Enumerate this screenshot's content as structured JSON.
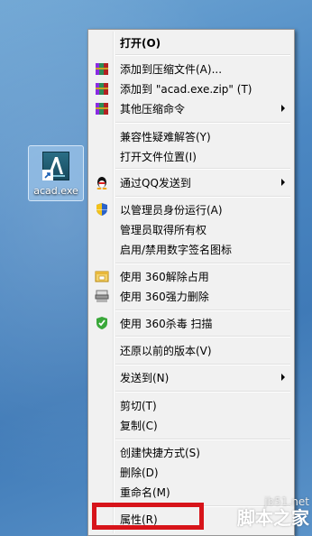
{
  "desktop": {
    "icon_label": "acad.exe"
  },
  "menu": {
    "items": [
      {
        "label": "打开(O)",
        "bold": true,
        "icon": ""
      },
      {
        "label": "添加到压缩文件(A)...",
        "icon": "winrar-books-icon"
      },
      {
        "label": "添加到 \"acad.exe.zip\" (T)",
        "icon": "winrar-books-icon"
      },
      {
        "label": "其他压缩命令",
        "icon": "winrar-books-icon",
        "submenu": true
      },
      {
        "label": "兼容性疑难解答(Y)"
      },
      {
        "label": "打开文件位置(I)"
      },
      {
        "label": "通过QQ发送到",
        "icon": "qq-penguin-icon",
        "submenu": true
      },
      {
        "label": "以管理员身份运行(A)",
        "icon": "uac-shield-icon"
      },
      {
        "label": "管理员取得所有权"
      },
      {
        "label": "启用/禁用数字签名图标"
      },
      {
        "label": "使用 360解除占用",
        "icon": "360-unlock-icon"
      },
      {
        "label": "使用 360强力删除",
        "icon": "360-shredder-icon"
      },
      {
        "label": "使用 360杀毒 扫描",
        "icon": "360-antivirus-shield-icon"
      },
      {
        "label": "还原以前的版本(V)"
      },
      {
        "label": "发送到(N)",
        "submenu": true
      },
      {
        "label": "剪切(T)"
      },
      {
        "label": "复制(C)"
      },
      {
        "label": "创建快捷方式(S)"
      },
      {
        "label": "删除(D)"
      },
      {
        "label": "重命名(M)"
      },
      {
        "label": "属性(R)"
      }
    ]
  },
  "colors": {
    "highlight_border": "#d7141a",
    "menu_bg": "#f1f1f1"
  },
  "watermark": {
    "url": "jb51.net",
    "name": "脚本之家"
  }
}
